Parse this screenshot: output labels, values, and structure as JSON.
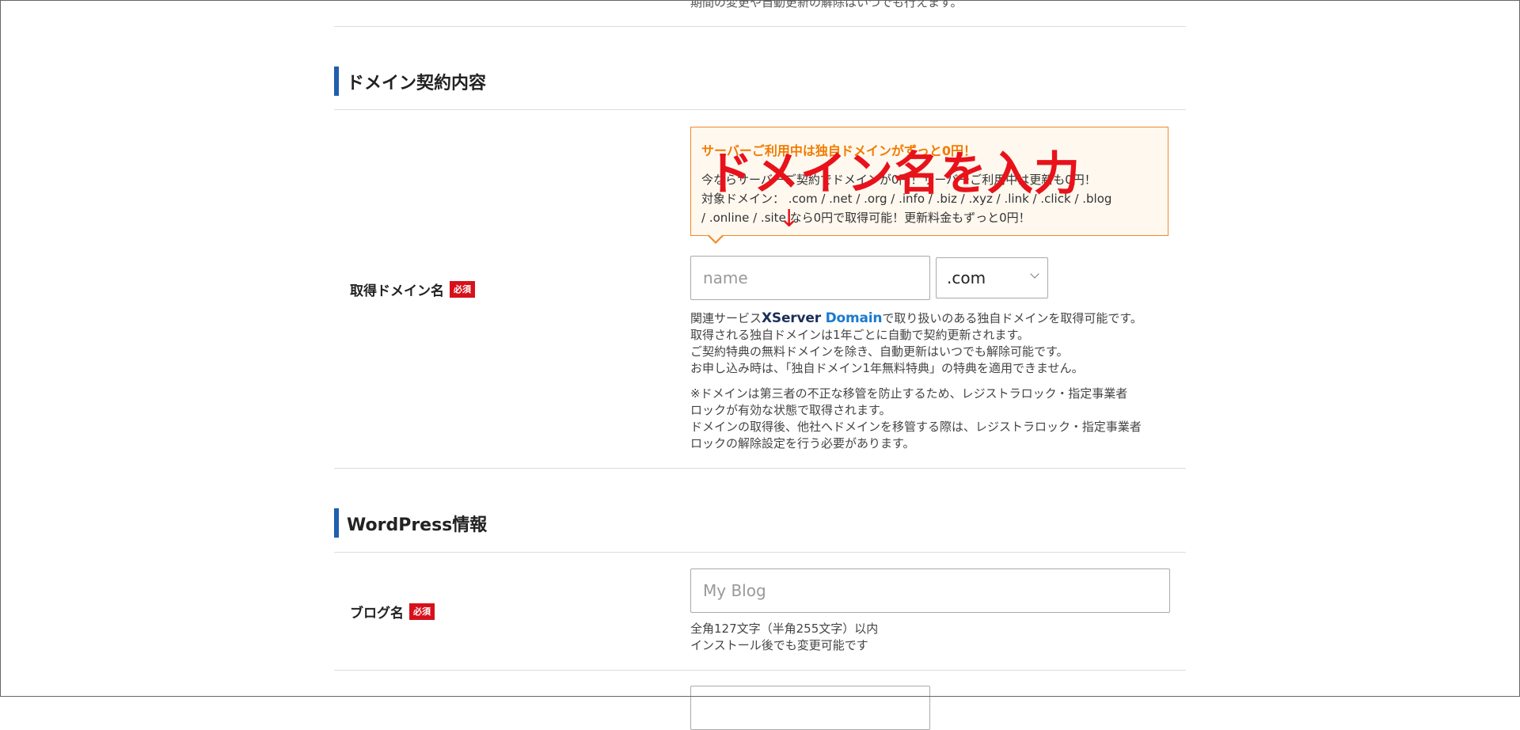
{
  "top_note": "期間の変更や自動更新の解除はいつでも行えます。",
  "colors": {
    "accent_bar": "#1f5fad",
    "required_badge": "#d7111b",
    "promo_border": "#f28a2a",
    "promo_title": "#f07c00",
    "annotation": "#e8121b"
  },
  "domain_section": {
    "title": "ドメイン契約内容",
    "field_label": "取得ドメイン名",
    "required_badge": "必須",
    "promo": {
      "title": "サーバーご利用中は独自ドメインがずっと0円！",
      "line1": "今ならサーバーご契約でドメインが0円！サーバーご利用中は更新も0円！",
      "line2": "対象ドメイン： .com / .net / .org / .info / .biz / .xyz / .link / .click / .blog",
      "line3": "/ .online / .site なら0円で取得可能！更新料金もずっと0円！"
    },
    "annotation": {
      "text": "ドメイン名を入力",
      "arrow": "↓",
      "arrow_icon": "down-arrow-icon"
    },
    "name_input": {
      "placeholder": "name",
      "value": ""
    },
    "tld_select": {
      "selected": ".com",
      "icon": "chevron-down-icon"
    },
    "help1": {
      "prefix": "関連サービス",
      "logo_part1": "XServer",
      "logo_part2": "Domain",
      "suffix": "で取り扱いのある独自ドメインを取得可能です。",
      "line2": "取得される独自ドメインは1年ごとに自動で契約更新されます。",
      "line3": "ご契約特典の無料ドメインを除き、自動更新はいつでも解除可能です。",
      "line4": "お申し込み時は、「独自ドメイン1年無料特典」の特典を適用できません。"
    },
    "help2": {
      "line1": "※ドメインは第三者の不正な移管を防止するため、レジストラロック・指定事業者",
      "line2": "ロックが有効な状態で取得されます。",
      "line3": "ドメインの取得後、他社へドメインを移管する際は、レジストラロック・指定事業者",
      "line4": "ロックの解除設定を行う必要があります。"
    }
  },
  "wordpress_section": {
    "title": "WordPress情報",
    "blog_label": "ブログ名",
    "required_badge": "必須",
    "blog_input": {
      "placeholder": "My Blog",
      "value": ""
    },
    "help_line1": "全角127文字（半角255文字）以内",
    "help_line2": "インストール後でも変更可能です"
  }
}
